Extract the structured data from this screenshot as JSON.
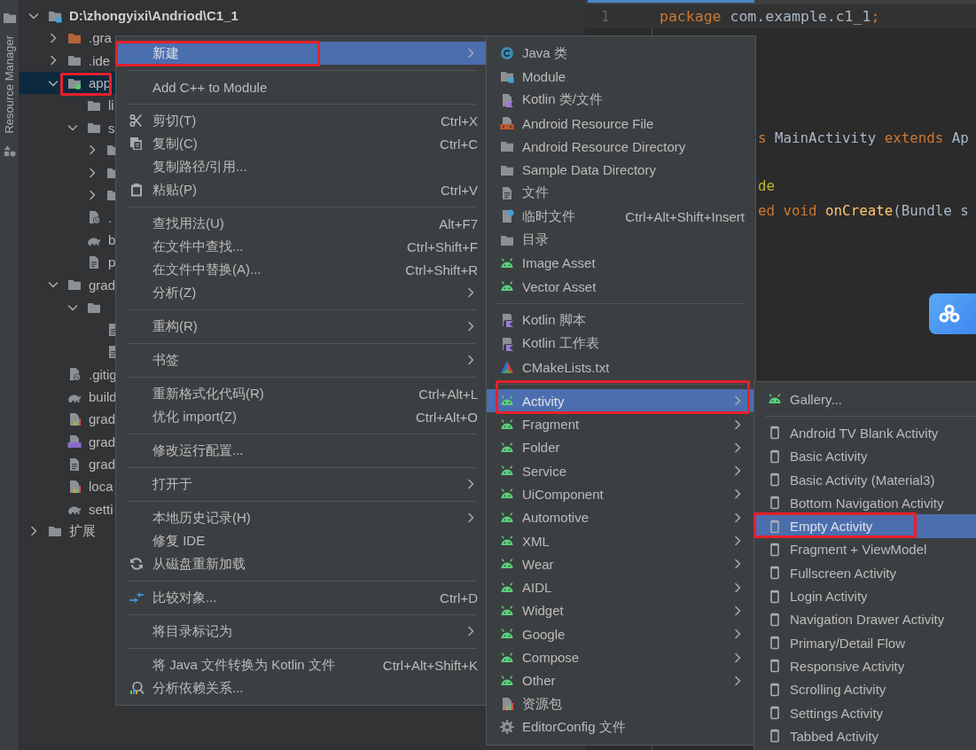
{
  "sidebar_strip": {
    "label": "Resource Manager"
  },
  "project_tree": [
    {
      "label": "D:\\zhongyixi\\Andriod\\C1_1",
      "kind": "module",
      "expanded": true,
      "selected": false,
      "children": [
        {
          "label": ".gra",
          "kind": "folder-orange",
          "expanded": false,
          "selected": false
        },
        {
          "label": ".ide",
          "kind": "folder",
          "expanded": false,
          "selected": false
        },
        {
          "label": "app",
          "kind": "module-dot",
          "expanded": true,
          "selected": true,
          "children": [
            {
              "label": "li",
              "kind": "folder",
              "selected": false
            },
            {
              "label": "s",
              "kind": "folder",
              "expanded": true,
              "selected": false,
              "children": [
                {
                  "kind": "folder",
                  "expanded": false,
                  "selected": false
                },
                {
                  "kind": "folder",
                  "expanded": false,
                  "selected": false
                },
                {
                  "kind": "folder",
                  "expanded": false,
                  "selected": false
                }
              ]
            },
            {
              "label": ".",
              "kind": "ignore",
              "selected": false
            },
            {
              "label": "b",
              "kind": "gradle",
              "selected": false
            },
            {
              "label": "p",
              "kind": "file",
              "selected": false
            }
          ]
        },
        {
          "label": "grad",
          "kind": "folder",
          "expanded": true,
          "selected": false,
          "children": [
            {
              "kind": "folder",
              "expanded": true,
              "selected": false,
              "children": [
                {
                  "kind": "file",
                  "selected": false
                },
                {
                  "kind": "file",
                  "selected": false
                }
              ]
            }
          ]
        },
        {
          "label": ".gitig",
          "kind": "ignore",
          "selected": false
        },
        {
          "label": "build",
          "kind": "gradle",
          "selected": false
        },
        {
          "label": "grad",
          "kind": "props",
          "selected": false
        },
        {
          "label": "grad",
          "kind": "cpp",
          "selected": false
        },
        {
          "label": "grad",
          "kind": "file",
          "selected": false
        },
        {
          "label": "loca",
          "kind": "props",
          "selected": false
        },
        {
          "label": "setti",
          "kind": "gradle",
          "selected": false
        }
      ]
    },
    {
      "label": "扩展",
      "kind": "folder",
      "expanded": false,
      "selected": false
    }
  ],
  "editor": {
    "lines": [
      {
        "number": "1",
        "tokens": [
          {
            "text": "package",
            "kind": "keyword"
          },
          {
            "text": " com.example.c1_1",
            "kind": "plain"
          },
          {
            "text": ";",
            "kind": "keyword"
          }
        ]
      },
      {
        "blank": true
      },
      {
        "blank": true
      },
      {
        "blank": true
      },
      {
        "blank": true
      },
      {
        "tokens": [
          {
            "text": "s",
            "kind": "keyword"
          },
          {
            "text": " MainActivity ",
            "kind": "plain"
          },
          {
            "text": "extends",
            "kind": "keyword"
          },
          {
            "text": " Ap",
            "kind": "plain"
          }
        ]
      },
      {
        "blank": true
      },
      {
        "tokens": [
          {
            "text": "de",
            "kind": "annotation"
          }
        ]
      },
      {
        "tokens": [
          {
            "text": "ed void ",
            "kind": "keyword"
          },
          {
            "text": "onCreate",
            "kind": "method"
          },
          {
            "text": "(Bundle s",
            "kind": "plain"
          }
        ]
      }
    ]
  },
  "context_menu": {
    "groups": [
      [
        {
          "label": "新建",
          "arrow": true,
          "selected": true
        }
      ],
      [
        {
          "label": "Add C++ to Module",
          "arrow": false,
          "selected": false
        }
      ],
      [
        {
          "label": "剪切(T)",
          "kind": "scissors",
          "shortcut": "Ctrl+X",
          "arrow": false,
          "selected": false
        },
        {
          "label": "复制(C)",
          "kind": "copy",
          "shortcut": "Ctrl+C",
          "arrow": false,
          "selected": false
        },
        {
          "label": "复制路径/引用...",
          "arrow": false,
          "selected": false
        },
        {
          "label": "粘贴(P)",
          "kind": "paste",
          "shortcut": "Ctrl+V",
          "arrow": false,
          "selected": false
        }
      ],
      [
        {
          "label": "查找用法(U)",
          "shortcut": "Alt+F7",
          "arrow": false,
          "selected": false
        },
        {
          "label": "在文件中查找...",
          "shortcut": "Ctrl+Shift+F",
          "arrow": false,
          "selected": false
        },
        {
          "label": "在文件中替换(A)...",
          "shortcut": "Ctrl+Shift+R",
          "arrow": false,
          "selected": false
        },
        {
          "label": "分析(Z)",
          "arrow": true,
          "selected": false
        }
      ],
      [
        {
          "label": "重构(R)",
          "arrow": true,
          "selected": false
        }
      ],
      [
        {
          "label": "书签",
          "arrow": true,
          "selected": false
        }
      ],
      [
        {
          "label": "重新格式化代码(R)",
          "shortcut": "Ctrl+Alt+L",
          "arrow": false,
          "selected": false
        },
        {
          "label": "优化 import(Z)",
          "shortcut": "Ctrl+Alt+O",
          "arrow": false,
          "selected": false
        }
      ],
      [
        {
          "label": "修改运行配置...",
          "arrow": false,
          "selected": false
        }
      ],
      [
        {
          "label": "打开于",
          "arrow": true,
          "selected": false
        }
      ],
      [
        {
          "label": "本地历史记录(H)",
          "arrow": true,
          "selected": false
        },
        {
          "label": "修复 IDE",
          "arrow": false,
          "selected": false
        },
        {
          "label": "从磁盘重新加载",
          "kind": "reload",
          "arrow": false,
          "selected": false
        }
      ],
      [
        {
          "label": "比较对象...",
          "kind": "compare",
          "shortcut": "Ctrl+D",
          "arrow": false,
          "selected": false
        }
      ],
      [
        {
          "label": "将目录标记为",
          "arrow": true,
          "selected": false
        }
      ],
      [
        {
          "label": "将 Java 文件转换为 Kotlin 文件",
          "shortcut": "Ctrl+Alt+Shift+K",
          "arrow": false,
          "selected": false
        },
        {
          "label": "分析依赖关系...",
          "kind": "deps",
          "arrow": false,
          "selected": false
        }
      ]
    ]
  },
  "new_submenu": {
    "groups": [
      [
        {
          "label": "Java 类",
          "kind": "java",
          "arrow": false,
          "selected": false
        },
        {
          "label": "Module",
          "kind": "module",
          "arrow": false,
          "selected": false
        },
        {
          "label": "Kotlin 类/文件",
          "kind": "kotlin",
          "arrow": false,
          "selected": false
        },
        {
          "label": "Android Resource File",
          "kind": "resource",
          "arrow": false,
          "selected": false
        },
        {
          "label": "Android Resource Directory",
          "kind": "folder",
          "arrow": false,
          "selected": false
        },
        {
          "label": "Sample Data Directory",
          "kind": "folder",
          "arrow": false,
          "selected": false
        },
        {
          "label": "文件",
          "kind": "file",
          "arrow": false,
          "selected": false
        },
        {
          "label": "临时文件",
          "kind": "scratch",
          "shortcut": "Ctrl+Alt+Shift+Insert",
          "arrow": false,
          "selected": false
        },
        {
          "label": "目录",
          "kind": "folder",
          "arrow": false,
          "selected": false
        },
        {
          "label": "Image Asset",
          "kind": "android",
          "arrow": false,
          "selected": false
        },
        {
          "label": "Vector Asset",
          "kind": "android",
          "arrow": false,
          "selected": false
        }
      ],
      [
        {
          "label": "Kotlin 脚本",
          "kind": "kts",
          "arrow": false,
          "selected": false
        },
        {
          "label": "Kotlin 工作表",
          "kind": "kts",
          "arrow": false,
          "selected": false
        },
        {
          "label": "CMakeLists.txt",
          "kind": "cmake",
          "arrow": false,
          "selected": false
        }
      ],
      [
        {
          "label": "Activity",
          "kind": "android",
          "arrow": true,
          "selected": true
        },
        {
          "label": "Fragment",
          "kind": "android",
          "arrow": true,
          "selected": false
        },
        {
          "label": "Folder",
          "kind": "android",
          "arrow": true,
          "selected": false
        },
        {
          "label": "Service",
          "kind": "android",
          "arrow": true,
          "selected": false
        },
        {
          "label": "UiComponent",
          "kind": "android",
          "arrow": true,
          "selected": false
        },
        {
          "label": "Automotive",
          "kind": "android",
          "arrow": true,
          "selected": false
        },
        {
          "label": "XML",
          "kind": "android",
          "arrow": true,
          "selected": false
        },
        {
          "label": "Wear",
          "kind": "android",
          "arrow": true,
          "selected": false
        },
        {
          "label": "AIDL",
          "kind": "android",
          "arrow": true,
          "selected": false
        },
        {
          "label": "Widget",
          "kind": "android",
          "arrow": true,
          "selected": false
        },
        {
          "label": "Google",
          "kind": "android",
          "arrow": true,
          "selected": false
        },
        {
          "label": "Compose",
          "kind": "android",
          "arrow": true,
          "selected": false
        },
        {
          "label": "Other",
          "kind": "android",
          "arrow": true,
          "selected": false
        },
        {
          "label": "资源包",
          "kind": "props",
          "arrow": false,
          "selected": false
        },
        {
          "label": "EditorConfig 文件",
          "kind": "gear",
          "arrow": false,
          "selected": false
        }
      ]
    ]
  },
  "activity_submenu": {
    "groups": [
      [
        {
          "label": "Gallery...",
          "kind": "android",
          "arrow": false,
          "selected": false
        }
      ],
      [
        {
          "label": "Android TV Blank Activity",
          "kind": "phone",
          "arrow": false,
          "selected": false
        },
        {
          "label": "Basic Activity",
          "kind": "phone",
          "arrow": false,
          "selected": false
        },
        {
          "label": "Basic Activity (Material3)",
          "kind": "phone",
          "arrow": false,
          "selected": false
        },
        {
          "label": "Bottom Navigation Activity",
          "kind": "phone",
          "arrow": false,
          "selected": false
        },
        {
          "label": "Empty Activity",
          "kind": "phone",
          "arrow": false,
          "selected": true
        },
        {
          "label": "Fragment + ViewModel",
          "kind": "phone",
          "arrow": false,
          "selected": false
        },
        {
          "label": "Fullscreen Activity",
          "kind": "phone",
          "arrow": false,
          "selected": false
        },
        {
          "label": "Login Activity",
          "kind": "phone",
          "arrow": false,
          "selected": false
        },
        {
          "label": "Navigation Drawer Activity",
          "kind": "phone",
          "arrow": false,
          "selected": false
        },
        {
          "label": "Primary/Detail Flow",
          "kind": "phone",
          "arrow": false,
          "selected": false
        },
        {
          "label": "Responsive Activity",
          "kind": "phone",
          "arrow": false,
          "selected": false
        },
        {
          "label": "Scrolling Activity",
          "kind": "phone",
          "arrow": false,
          "selected": false
        },
        {
          "label": "Settings Activity",
          "kind": "phone",
          "arrow": false,
          "selected": false
        },
        {
          "label": "Tabbed Activity",
          "kind": "phone",
          "arrow": false,
          "selected": false
        }
      ]
    ]
  }
}
